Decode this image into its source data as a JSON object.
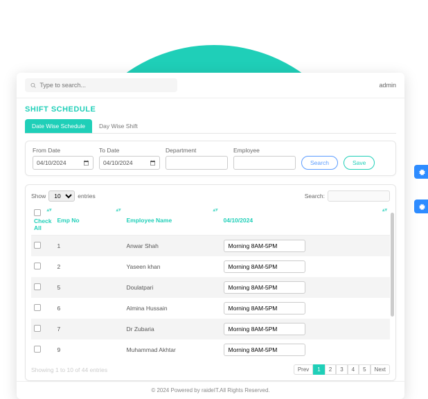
{
  "topbar": {
    "search_placeholder": "Type to search...",
    "user": "admin"
  },
  "page_title": "SHIFT SCHEDULE",
  "tabs": {
    "active": "Date Wise Schedule",
    "inactive": "Day Wise Shift"
  },
  "filters": {
    "from_label": "From Date",
    "from_value": "04/10/2024",
    "to_label": "To Date",
    "to_value": "04/10/2024",
    "department_label": "Department",
    "department_value": "",
    "employee_label": "Employee",
    "employee_value": "",
    "search_btn": "Search",
    "save_btn": "Save"
  },
  "table": {
    "show_label": "Show",
    "entries_label": "entries",
    "page_size": "10",
    "search_label": "Search:",
    "search_value": "",
    "headers": {
      "check_all": "Check All",
      "emp_no": "Emp No",
      "name": "Employee Name",
      "date": "04/10/2024"
    },
    "rows": [
      {
        "emp_no": "1",
        "name": "Anwar Shah",
        "shift": "Morning 8AM-5PM"
      },
      {
        "emp_no": "2",
        "name": "Yaseen khan",
        "shift": "Morning 8AM-5PM"
      },
      {
        "emp_no": "5",
        "name": "Doulatpari",
        "shift": "Morning 8AM-5PM"
      },
      {
        "emp_no": "6",
        "name": "Almina Hussain",
        "shift": "Morning 8AM-5PM"
      },
      {
        "emp_no": "7",
        "name": "Dr Zubaria",
        "shift": "Morning 8AM-5PM"
      },
      {
        "emp_no": "9",
        "name": "Muhammad Akhtar",
        "shift": "Morning 8AM-5PM"
      }
    ],
    "showing_text": "Showing 1 to 10 of 44 entries",
    "pagination": {
      "prev": "Prev",
      "pages": [
        "1",
        "2",
        "3",
        "4",
        "5"
      ],
      "next": "Next",
      "active": "1"
    }
  },
  "footer": "© 2024 Powered by raideIT.All Rights Reserved.",
  "colors": {
    "accent": "#1fcfb8",
    "blue": "#2e8cff"
  }
}
